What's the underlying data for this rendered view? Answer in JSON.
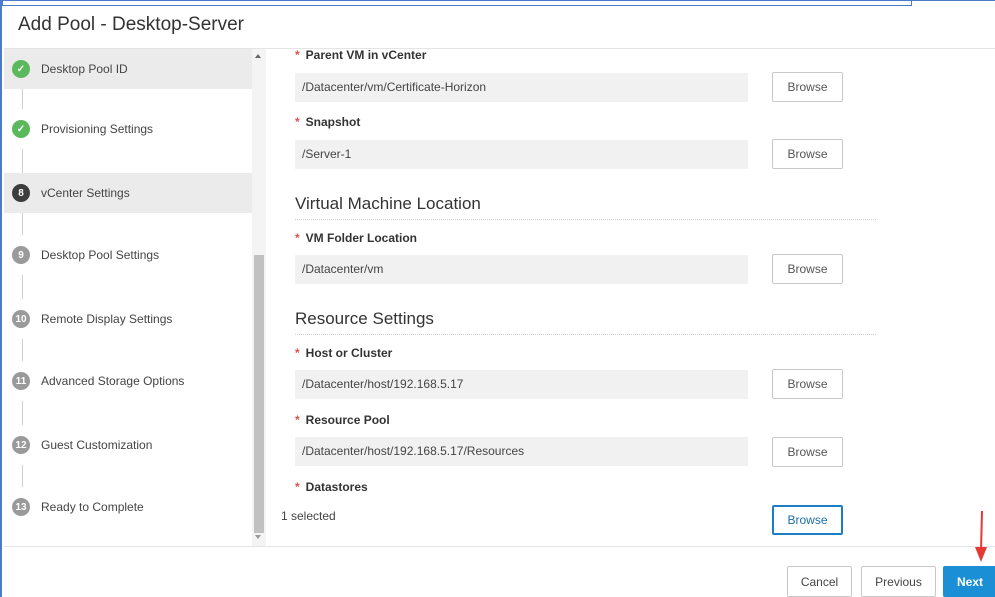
{
  "window": {
    "title": "Add Pool - Desktop-Server"
  },
  "sidebar": {
    "steps": [
      {
        "number": "✓",
        "label": "Desktop Pool ID",
        "state": "done"
      },
      {
        "number": "✓",
        "label": "Provisioning Settings",
        "state": "done"
      },
      {
        "number": "8",
        "label": "vCenter Settings",
        "state": "current"
      },
      {
        "number": "9",
        "label": "Desktop Pool Settings",
        "state": "todo"
      },
      {
        "number": "10",
        "label": "Remote Display Settings",
        "state": "todo"
      },
      {
        "number": "11",
        "label": "Advanced Storage Options",
        "state": "todo"
      },
      {
        "number": "12",
        "label": "Guest Customization",
        "state": "todo"
      },
      {
        "number": "13",
        "label": "Ready to Complete",
        "state": "todo"
      }
    ]
  },
  "form": {
    "required_mark": "*",
    "browse_label": "Browse",
    "parent_vm": {
      "label": "Parent VM in vCenter",
      "value": "/Datacenter/vm/Certificate-Horizon"
    },
    "snapshot": {
      "label": "Snapshot",
      "value": "/Server-1"
    },
    "vm_location_section": "Virtual Machine Location",
    "vm_folder": {
      "label": "VM Folder Location",
      "value": "/Datacenter/vm"
    },
    "resource_section": "Resource Settings",
    "host_cluster": {
      "label": "Host or Cluster",
      "value": "/Datacenter/host/192.168.5.17"
    },
    "resource_pool": {
      "label": "Resource Pool",
      "value": "/Datacenter/host/192.168.5.17/Resources"
    },
    "datastores": {
      "label": "Datastores",
      "value": "1 selected"
    }
  },
  "footer": {
    "cancel_label": "Cancel",
    "previous_label": "Previous",
    "next_label": "Next"
  },
  "colors": {
    "accent": "#1b8fd6",
    "done": "#5cb85c",
    "current": "#3d3d3d",
    "todo": "#9a9a9a",
    "required": "#d9534f",
    "annotation_arrow": "#e53935"
  },
  "icons": {
    "done_step": "checkmark-icon",
    "annotation": "red-arrow-icon"
  }
}
